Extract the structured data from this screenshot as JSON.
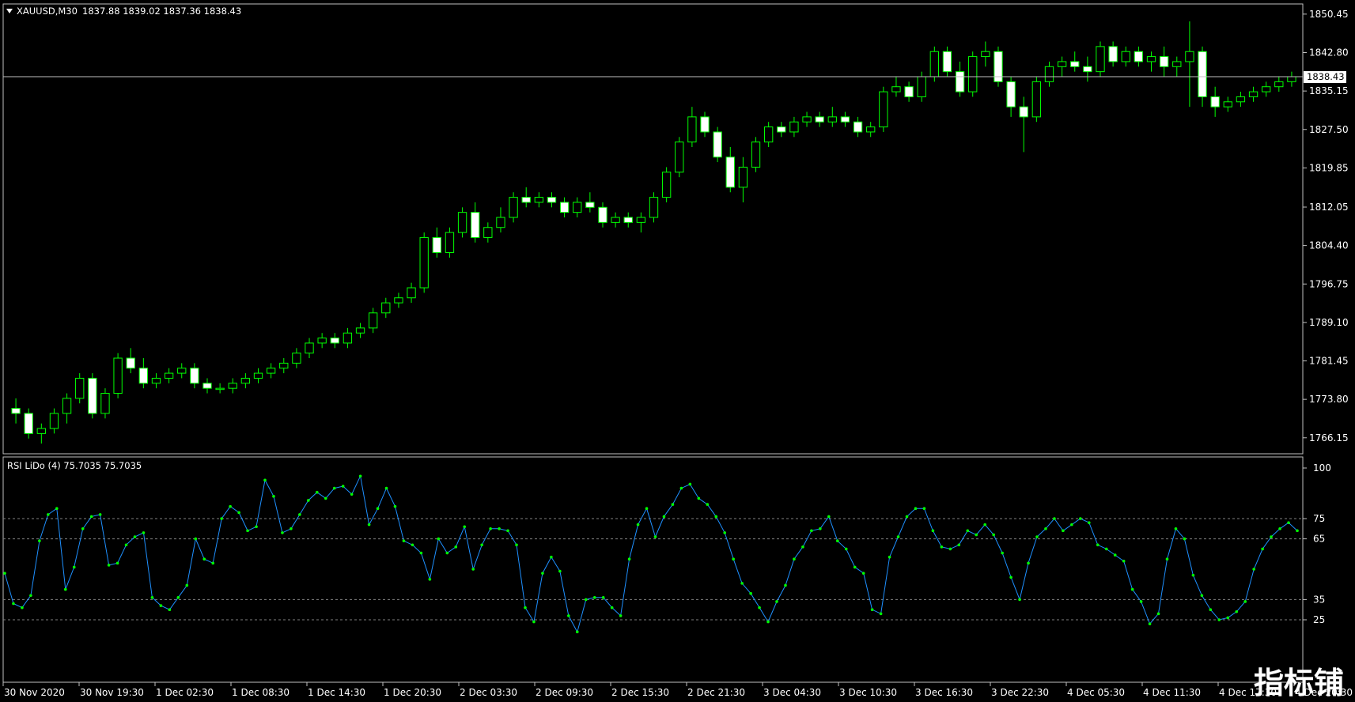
{
  "window": {
    "symbol_header": "XAUUSD,M30",
    "ohlc_text": "1837.88 1839.02 1837.36 1838.43",
    "current_price_label": "1838.43",
    "watermark_text": "指标铺"
  },
  "colors": {
    "background": "#000000",
    "bull_candle": "#00ff00",
    "bear_candle": "#ffffff",
    "rsi_line": "#1e90ff",
    "rsi_point": "#00ff00",
    "grid_level": "#808080",
    "axis": "#c0c0c0"
  },
  "icons": {
    "dropdown": "triangle-down-icon"
  },
  "price_axis": {
    "labels": [
      "1850.45",
      "1842.80",
      "1835.15",
      "1827.50",
      "1819.85",
      "1812.05",
      "1804.40",
      "1796.75",
      "1789.10",
      "1781.45",
      "1773.80",
      "1766.15"
    ],
    "range": [
      1763.6,
      1852.0
    ]
  },
  "rsi_panel": {
    "title": "RSI LiDo (4) 75.7035 75.7035",
    "levels": [
      25,
      35,
      65,
      75
    ],
    "level_labels": [
      "100",
      "75",
      "65",
      "35",
      "25"
    ],
    "range": [
      0,
      100
    ]
  },
  "time_axis": {
    "labels": [
      "30 Nov 2020",
      "30 Nov 19:30",
      "1 Dec 02:30",
      "1 Dec 08:30",
      "1 Dec 14:30",
      "1 Dec 20:30",
      "2 Dec 03:30",
      "2 Dec 09:30",
      "2 Dec 15:30",
      "2 Dec 21:30",
      "3 Dec 04:30",
      "3 Dec 10:30",
      "3 Dec 16:30",
      "3 Dec 22:30",
      "4 Dec 05:30",
      "4 Dec 11:30",
      "4 Dec 17:30",
      "4 Dec 20:30"
    ]
  },
  "chart_data": {
    "type": "candlestick",
    "symbol": "XAUUSD",
    "timeframe": "M30",
    "candles": [
      [
        1772,
        1774,
        1769,
        1771
      ],
      [
        1771,
        1772,
        1766,
        1767
      ],
      [
        1767,
        1769,
        1765,
        1768
      ],
      [
        1768,
        1772,
        1767,
        1771
      ],
      [
        1771,
        1775,
        1769,
        1774
      ],
      [
        1774,
        1779,
        1773,
        1778
      ],
      [
        1778,
        1779,
        1770,
        1771
      ],
      [
        1771,
        1776,
        1770,
        1775
      ],
      [
        1775,
        1783,
        1774,
        1782
      ],
      [
        1782,
        1784,
        1779,
        1780
      ],
      [
        1780,
        1782,
        1776,
        1777
      ],
      [
        1777,
        1779,
        1776,
        1778
      ],
      [
        1778,
        1780,
        1777,
        1779
      ],
      [
        1779,
        1781,
        1778,
        1780
      ],
      [
        1780,
        1781,
        1776,
        1777
      ],
      [
        1777,
        1778,
        1775,
        1776
      ],
      [
        1776,
        1777,
        1775,
        1776
      ],
      [
        1776,
        1778,
        1775,
        1777
      ],
      [
        1777,
        1779,
        1776,
        1778
      ],
      [
        1778,
        1780,
        1777,
        1779
      ],
      [
        1779,
        1781,
        1778,
        1780
      ],
      [
        1780,
        1782,
        1779,
        1781
      ],
      [
        1781,
        1784,
        1780,
        1783
      ],
      [
        1783,
        1786,
        1782,
        1785
      ],
      [
        1785,
        1787,
        1784,
        1786
      ],
      [
        1786,
        1787,
        1784,
        1785
      ],
      [
        1785,
        1788,
        1784,
        1787
      ],
      [
        1787,
        1789,
        1786,
        1788
      ],
      [
        1788,
        1792,
        1787,
        1791
      ],
      [
        1791,
        1794,
        1790,
        1793
      ],
      [
        1793,
        1795,
        1792,
        1794
      ],
      [
        1794,
        1797,
        1793,
        1796
      ],
      [
        1796,
        1807,
        1795,
        1806
      ],
      [
        1806,
        1808,
        1802,
        1803
      ],
      [
        1803,
        1808,
        1802,
        1807
      ],
      [
        1807,
        1812,
        1806,
        1811
      ],
      [
        1811,
        1813,
        1805,
        1806
      ],
      [
        1806,
        1809,
        1805,
        1808
      ],
      [
        1808,
        1812,
        1807,
        1810
      ],
      [
        1810,
        1815,
        1809,
        1814
      ],
      [
        1814,
        1816,
        1812,
        1813
      ],
      [
        1813,
        1815,
        1812,
        1814
      ],
      [
        1814,
        1815,
        1812,
        1813
      ],
      [
        1813,
        1814,
        1810,
        1811
      ],
      [
        1811,
        1814,
        1810,
        1813
      ],
      [
        1813,
        1815,
        1811,
        1812
      ],
      [
        1812,
        1813,
        1808,
        1809
      ],
      [
        1809,
        1811,
        1808,
        1810
      ],
      [
        1810,
        1811,
        1808,
        1809
      ],
      [
        1809,
        1811,
        1807,
        1810
      ],
      [
        1810,
        1815,
        1809,
        1814
      ],
      [
        1814,
        1820,
        1813,
        1819
      ],
      [
        1819,
        1826,
        1818,
        1825
      ],
      [
        1825,
        1832,
        1824,
        1830
      ],
      [
        1830,
        1831,
        1826,
        1827
      ],
      [
        1827,
        1828,
        1821,
        1822
      ],
      [
        1822,
        1824,
        1815,
        1816
      ],
      [
        1816,
        1822,
        1813,
        1820
      ],
      [
        1820,
        1826,
        1819,
        1825
      ],
      [
        1825,
        1829,
        1824,
        1828
      ],
      [
        1828,
        1829,
        1826,
        1827
      ],
      [
        1827,
        1830,
        1826,
        1829
      ],
      [
        1829,
        1831,
        1828,
        1830
      ],
      [
        1830,
        1831,
        1828,
        1829
      ],
      [
        1829,
        1832,
        1828,
        1830
      ],
      [
        1830,
        1831,
        1828,
        1829
      ],
      [
        1829,
        1830,
        1826,
        1827
      ],
      [
        1827,
        1829,
        1826,
        1828
      ],
      [
        1828,
        1836,
        1827,
        1835
      ],
      [
        1835,
        1838,
        1834,
        1836
      ],
      [
        1836,
        1837,
        1833,
        1834
      ],
      [
        1834,
        1839,
        1833,
        1838
      ],
      [
        1838,
        1844,
        1837,
        1843
      ],
      [
        1843,
        1844,
        1838,
        1839
      ],
      [
        1839,
        1841,
        1834,
        1835
      ],
      [
        1835,
        1843,
        1834,
        1842
      ],
      [
        1842,
        1845,
        1840,
        1843
      ],
      [
        1843,
        1844,
        1836,
        1837
      ],
      [
        1837,
        1838,
        1830,
        1832
      ],
      [
        1832,
        1834,
        1823,
        1830
      ],
      [
        1830,
        1838,
        1829,
        1837
      ],
      [
        1837,
        1841,
        1836,
        1840
      ],
      [
        1840,
        1842,
        1838,
        1841
      ],
      [
        1841,
        1843,
        1839,
        1840
      ],
      [
        1840,
        1842,
        1837,
        1839
      ],
      [
        1839,
        1845,
        1838,
        1844
      ],
      [
        1844,
        1845,
        1840,
        1841
      ],
      [
        1841,
        1844,
        1840,
        1843
      ],
      [
        1843,
        1844,
        1840,
        1841
      ],
      [
        1841,
        1843,
        1839,
        1842
      ],
      [
        1842,
        1844,
        1838,
        1840
      ],
      [
        1840,
        1842,
        1838,
        1841
      ],
      [
        1841,
        1849,
        1832,
        1843
      ],
      [
        1843,
        1844,
        1832,
        1834
      ],
      [
        1834,
        1836,
        1830,
        1832
      ],
      [
        1832,
        1834,
        1831,
        1833
      ],
      [
        1833,
        1835,
        1832,
        1834
      ],
      [
        1834,
        1836,
        1833,
        1835
      ],
      [
        1835,
        1837,
        1834,
        1836
      ],
      [
        1836,
        1838,
        1835,
        1837
      ],
      [
        1837,
        1839,
        1836,
        1838
      ]
    ],
    "rsi": [
      48,
      33,
      31,
      37,
      64,
      77,
      80,
      40,
      51,
      70,
      76,
      77,
      52,
      53,
      62,
      66,
      68,
      36,
      32,
      30,
      36,
      42,
      65,
      55,
      53,
      75,
      81,
      78,
      69,
      71,
      94,
      86,
      68,
      70,
      77,
      84,
      88,
      85,
      90,
      91,
      87,
      96,
      72,
      80,
      90,
      81,
      64,
      62,
      58,
      45,
      65,
      58,
      61,
      71,
      50,
      62,
      70,
      70,
      69,
      62,
      31,
      24,
      48,
      56,
      49,
      27,
      19,
      35,
      36,
      36,
      31,
      27,
      55,
      72,
      80,
      66,
      76,
      82,
      90,
      92,
      85,
      82,
      76,
      68,
      55,
      43,
      38,
      31,
      24,
      34,
      42,
      55,
      61,
      69,
      70,
      76,
      64,
      60,
      51,
      48,
      30,
      28,
      56,
      66,
      76,
      80,
      80,
      69,
      61,
      60,
      62,
      69,
      67,
      72,
      67,
      58,
      46,
      35,
      53,
      66,
      70,
      75,
      69,
      72,
      75,
      73,
      62,
      60,
      57,
      54,
      40,
      34,
      23,
      28,
      55,
      70,
      65,
      47,
      37,
      30,
      25,
      26,
      29,
      34,
      50,
      60,
      66,
      70,
      73,
      69
    ],
    "rsi_last": 75.7035,
    "rsi_levels": [
      25,
      35,
      65,
      75
    ]
  }
}
